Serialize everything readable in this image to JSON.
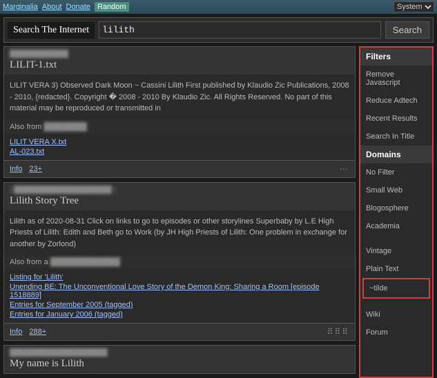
{
  "topbar": {
    "links": [
      "Marginalia",
      "About",
      "Donate"
    ],
    "random": "Random",
    "system": "System"
  },
  "search": {
    "title": "Search The Internet",
    "value": "lilith",
    "button": "Search"
  },
  "results": [
    {
      "url": "example-redacted",
      "title": "LILIT-1.txt",
      "body": "LILIT VERA 3) Observed Dark Moon ~ Cassini Lilith First published by Klaudio Zic Publications, 2008 - 2010, {redacted}. Copyright � 2008 - 2010 By Klaudio Zic. All Rights Reserved. No part of this material may be reproduced or transmitted in",
      "also": "Also from",
      "links": [
        "LILIT VERA X.txt",
        "AL-023.txt"
      ],
      "info": "Info",
      "count": "23+",
      "dots": "⋯"
    },
    {
      "url": "example-redacted",
      "title": "Lilith Story Tree",
      "body": "Lilith as of 2020-08-31 Click on links to go to episodes or other storylines Superbaby by L.E High Priests of Lilith: Edith and Beth go to Work (by JH High Priests of Lilith: One problem in exchange for another by Zorlond)",
      "also": "Also from a",
      "links": [
        "Listing for 'Lilith'",
        "Unending BE: The Unconventional Love Story of the Demon King: Sharing a Room [episode 1518889]",
        "Entries for September 2005 (tagged)",
        "Entries for January 2006 (tagged)"
      ],
      "info": "Info",
      "count": "288+",
      "dots": "⠿⠿⠿"
    },
    {
      "url": "example-redacted",
      "title": "My name is Lilith"
    }
  ],
  "sidebar": {
    "filters_label": "Filters",
    "filters": [
      "Remove Javascript",
      "Reduce Adtech",
      "Recent Results",
      "Search In Title"
    ],
    "domains_label": "Domains",
    "domains": [
      "No Filter",
      "Small Web",
      "Blogosphere",
      "Academia"
    ],
    "domains2": [
      "Vintage",
      "Plain Text"
    ],
    "tilde": "~tilde",
    "domains3": [
      "Wiki",
      "Forum"
    ]
  }
}
